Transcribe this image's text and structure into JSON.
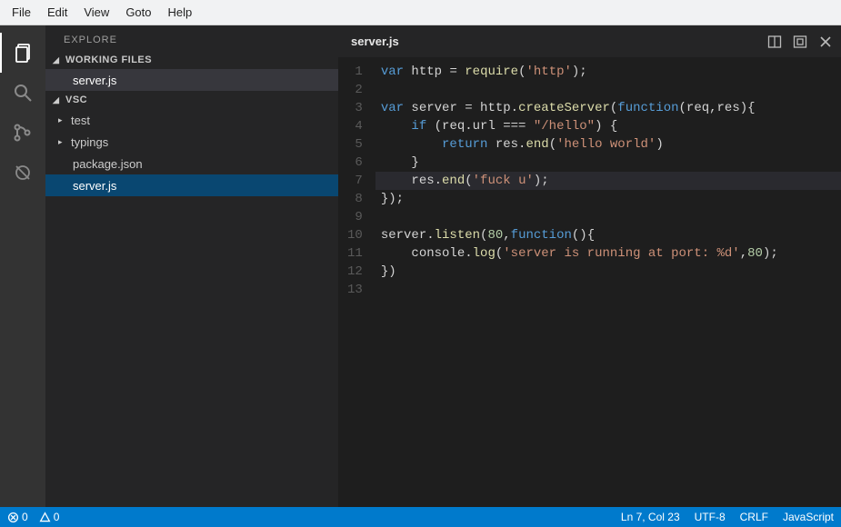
{
  "menubar": {
    "items": [
      "File",
      "Edit",
      "View",
      "Goto",
      "Help"
    ]
  },
  "activity": {
    "icons": [
      "files",
      "search",
      "git",
      "debug"
    ]
  },
  "sidebar": {
    "title": "EXPLORE",
    "workingFiles": {
      "header": "WORKING FILES",
      "items": [
        {
          "name": "server.js",
          "selected": true
        }
      ]
    },
    "project": {
      "header": "VSC",
      "items": [
        {
          "name": "test",
          "kind": "folder"
        },
        {
          "name": "typings",
          "kind": "folder"
        },
        {
          "name": "package.json",
          "kind": "file"
        },
        {
          "name": "server.js",
          "kind": "file",
          "selected": true
        }
      ]
    }
  },
  "editor": {
    "tab": "server.js",
    "activeLine": 7,
    "gutter": [
      "1",
      "2",
      "3",
      "4",
      "5",
      "6",
      "7",
      "8",
      "9",
      "10",
      "11",
      "12",
      "13"
    ],
    "code": [
      [
        [
          "kw",
          "var"
        ],
        [
          "punc",
          " http "
        ],
        [
          "punc",
          "= "
        ],
        [
          "func",
          "require"
        ],
        [
          "punc",
          "("
        ],
        [
          "str",
          "'http'"
        ],
        [
          "punc",
          ");"
        ]
      ],
      [],
      [
        [
          "kw",
          "var"
        ],
        [
          "punc",
          " server = http."
        ],
        [
          "func",
          "createServer"
        ],
        [
          "punc",
          "("
        ],
        [
          "kw",
          "function"
        ],
        [
          "punc",
          "(req,res){"
        ]
      ],
      [
        [
          "punc",
          "    "
        ],
        [
          "kw",
          "if"
        ],
        [
          "punc",
          " (req.url === "
        ],
        [
          "str",
          "\"/hello\""
        ],
        [
          "punc",
          ") {"
        ]
      ],
      [
        [
          "punc",
          "        "
        ],
        [
          "kw",
          "return"
        ],
        [
          "punc",
          " res."
        ],
        [
          "func",
          "end"
        ],
        [
          "punc",
          "("
        ],
        [
          "str",
          "'hello world'"
        ],
        [
          "punc",
          ")"
        ]
      ],
      [
        [
          "punc",
          "    }"
        ]
      ],
      [
        [
          "punc",
          "    res."
        ],
        [
          "func",
          "end"
        ],
        [
          "punc",
          "("
        ],
        [
          "str",
          "'fuck u'"
        ],
        [
          "punc",
          ");"
        ]
      ],
      [
        [
          "punc",
          "});"
        ]
      ],
      [],
      [
        [
          "punc",
          "server."
        ],
        [
          "func",
          "listen"
        ],
        [
          "punc",
          "("
        ],
        [
          "num",
          "80"
        ],
        [
          "punc",
          ","
        ],
        [
          "kw",
          "function"
        ],
        [
          "punc",
          "(){"
        ]
      ],
      [
        [
          "punc",
          "    console."
        ],
        [
          "func",
          "log"
        ],
        [
          "punc",
          "("
        ],
        [
          "str",
          "'server is running at port: %d'"
        ],
        [
          "punc",
          ","
        ],
        [
          "num",
          "80"
        ],
        [
          "punc",
          ");"
        ]
      ],
      [
        [
          "punc",
          "})"
        ]
      ],
      []
    ]
  },
  "status": {
    "errors": "0",
    "warnings": "0",
    "cursor": "Ln 7, Col 23",
    "encoding": "UTF-8",
    "eol": "CRLF",
    "lang": "JavaScript"
  }
}
